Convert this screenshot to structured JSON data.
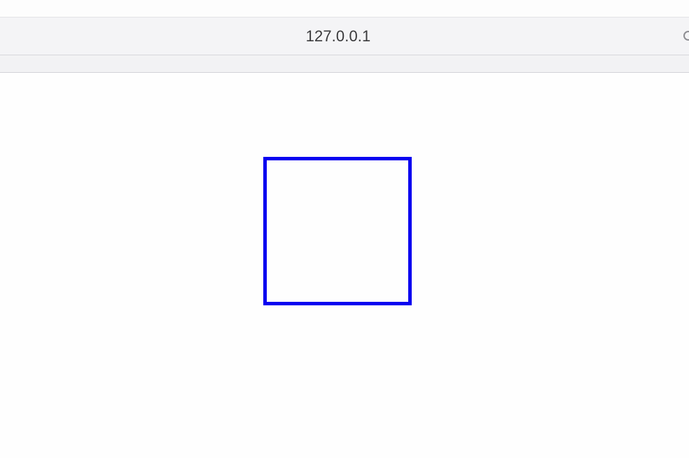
{
  "browser": {
    "address": "127.0.0.1",
    "reload_icon": "reload-icon"
  },
  "page": {
    "shape": "square-outline",
    "shape_color": "#0a00f0"
  }
}
